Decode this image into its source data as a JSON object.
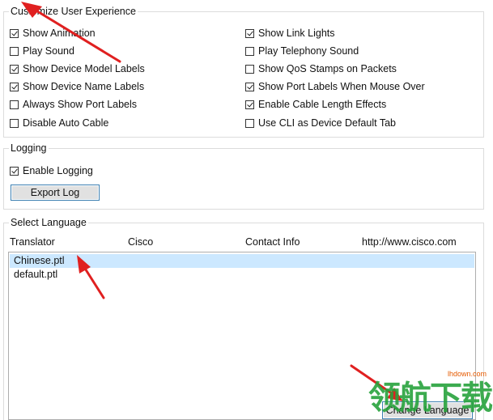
{
  "customize": {
    "legend": "Customize User Experience",
    "left": [
      {
        "label": "Show Animation",
        "checked": true
      },
      {
        "label": "Play Sound",
        "checked": false
      },
      {
        "label": "Show Device Model Labels",
        "checked": true
      },
      {
        "label": "Show Device Name Labels",
        "checked": true
      },
      {
        "label": "Always Show Port Labels",
        "checked": false
      },
      {
        "label": "Disable Auto Cable",
        "checked": false
      }
    ],
    "right": [
      {
        "label": "Show Link Lights",
        "checked": true
      },
      {
        "label": "Play Telephony Sound",
        "checked": false
      },
      {
        "label": "Show QoS Stamps on Packets",
        "checked": false
      },
      {
        "label": "Show Port Labels When Mouse Over",
        "checked": true
      },
      {
        "label": "Enable Cable Length Effects",
        "checked": true
      },
      {
        "label": "Use CLI as Device Default Tab",
        "checked": false
      }
    ]
  },
  "logging": {
    "legend": "Logging",
    "enable_label": "Enable Logging",
    "enable_checked": true,
    "export_label": "Export Log"
  },
  "language": {
    "legend": "Select Language",
    "columns": [
      "Translator",
      "Cisco",
      "Contact Info",
      "http://www.cisco.com"
    ],
    "items": [
      {
        "name": "Chinese.ptl",
        "selected": true
      },
      {
        "name": "default.ptl",
        "selected": false
      }
    ],
    "change_label": "Change Language"
  },
  "watermark": {
    "text": "领航下载",
    "url": "lhdown.com"
  },
  "colors": {
    "annotation_arrow": "#e02020",
    "selection": "#cce8ff",
    "button_border": "#3c7fb1"
  }
}
